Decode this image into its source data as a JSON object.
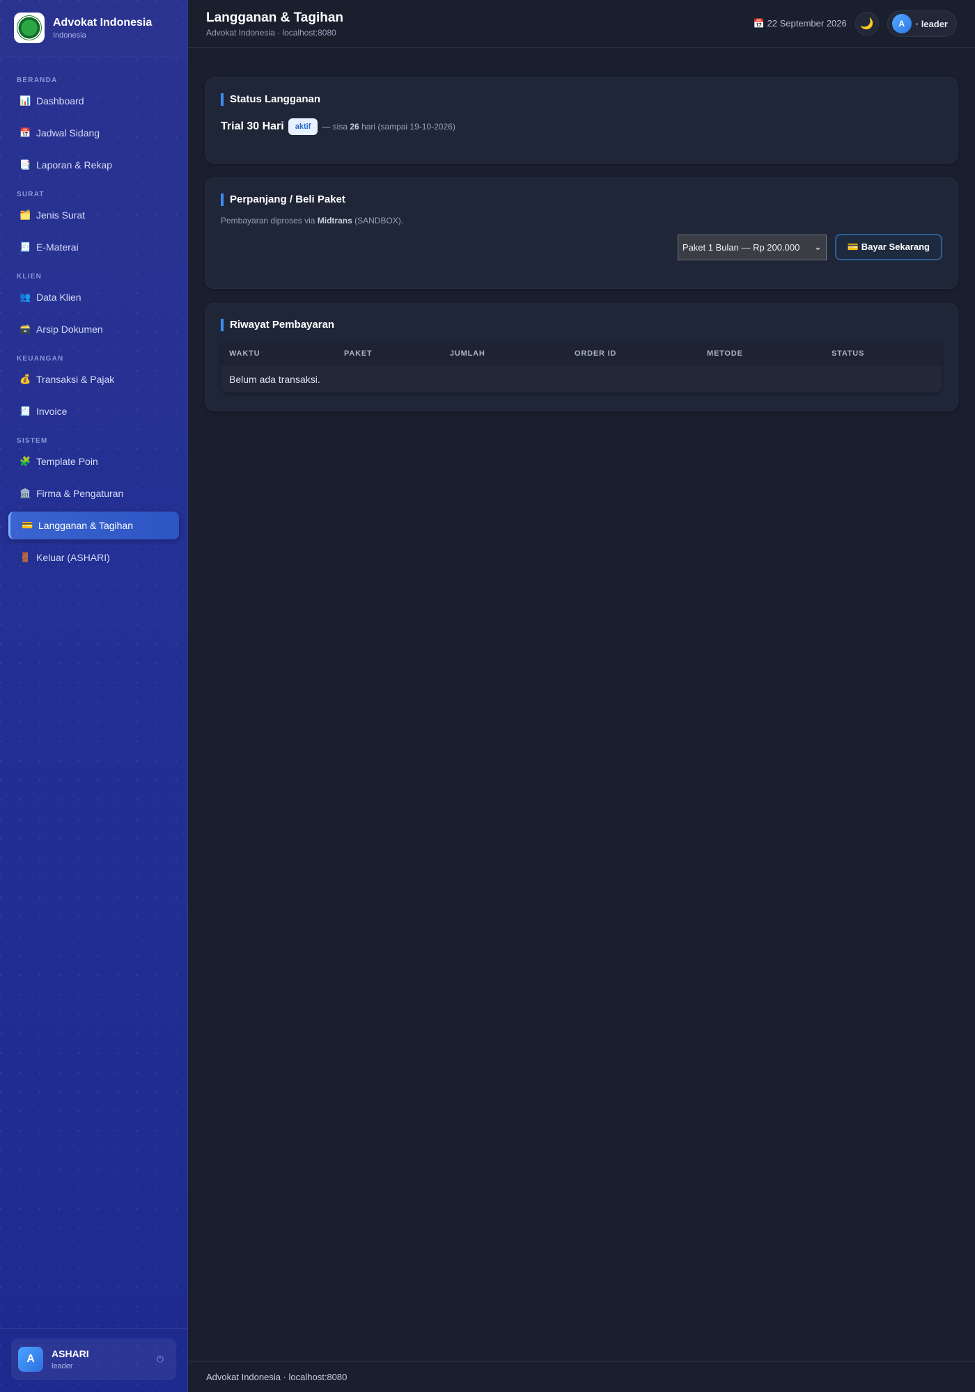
{
  "brand": {
    "title": "Advokat Indonesia",
    "subtitle": "Indonesia"
  },
  "sidebar": {
    "sections": [
      {
        "label": "BERANDA",
        "items": [
          {
            "icon": "📊",
            "label": "Dashboard"
          },
          {
            "icon": "📅",
            "label": "Jadwal Sidang"
          },
          {
            "icon": "📑",
            "label": "Laporan & Rekap"
          }
        ]
      },
      {
        "label": "SURAT",
        "items": [
          {
            "icon": "🗂️",
            "label": "Jenis Surat"
          },
          {
            "icon": "🧾",
            "label": "E-Materai"
          }
        ]
      },
      {
        "label": "KLIEN",
        "items": [
          {
            "icon": "👥",
            "label": "Data Klien"
          },
          {
            "icon": "🗃️",
            "label": "Arsip Dokumen"
          }
        ]
      },
      {
        "label": "KEUANGAN",
        "items": [
          {
            "icon": "💰",
            "label": "Transaksi & Pajak"
          },
          {
            "icon": "🧾",
            "label": "Invoice"
          }
        ]
      },
      {
        "label": "SISTEM",
        "items": [
          {
            "icon": "🧩",
            "label": "Template Poin"
          },
          {
            "icon": "🏛️",
            "label": "Firma & Pengaturan"
          },
          {
            "icon": "💳",
            "label": "Langganan & Tagihan",
            "active": true
          },
          {
            "icon": "🚪",
            "label": "Keluar (ASHARI)"
          }
        ]
      }
    ],
    "user": {
      "initial": "A",
      "name": "ASHARI",
      "role": "leader",
      "power_icon": "⏻"
    }
  },
  "header": {
    "title": "Langganan & Tagihan",
    "subtitle": "Advokat Indonesia · localhost:8080",
    "date": "📅 22 September 2026",
    "theme_icon": "🌙",
    "profile_initial": "A",
    "profile_label": "· leader"
  },
  "status_card": {
    "title": "Status Langganan",
    "plan": "Trial 30 Hari",
    "badge": "aktif",
    "prefix": "— sisa",
    "days": "26",
    "suffix": "hari (sampai 19-10-2026)"
  },
  "renew_card": {
    "title": "Perpanjang / Beli Paket",
    "note_prefix": "Pembayaran diproses via",
    "note_provider": "Midtrans",
    "note_suffix": "(SANDBOX).",
    "select_value": "Paket 1 Bulan — Rp 200.000",
    "pay_button": "💳 Bayar Sekarang"
  },
  "history_card": {
    "title": "Riwayat Pembayaran",
    "columns": [
      "WAKTU",
      "PAKET",
      "JUMLAH",
      "ORDER ID",
      "METODE",
      "STATUS"
    ],
    "empty_text": "Belum ada transaksi."
  },
  "footer": {
    "text": "Advokat Indonesia · localhost:8080"
  },
  "colors": {
    "accent": "#3d8cf0",
    "sidebar": "#243094",
    "background": "#1a1f2e"
  }
}
